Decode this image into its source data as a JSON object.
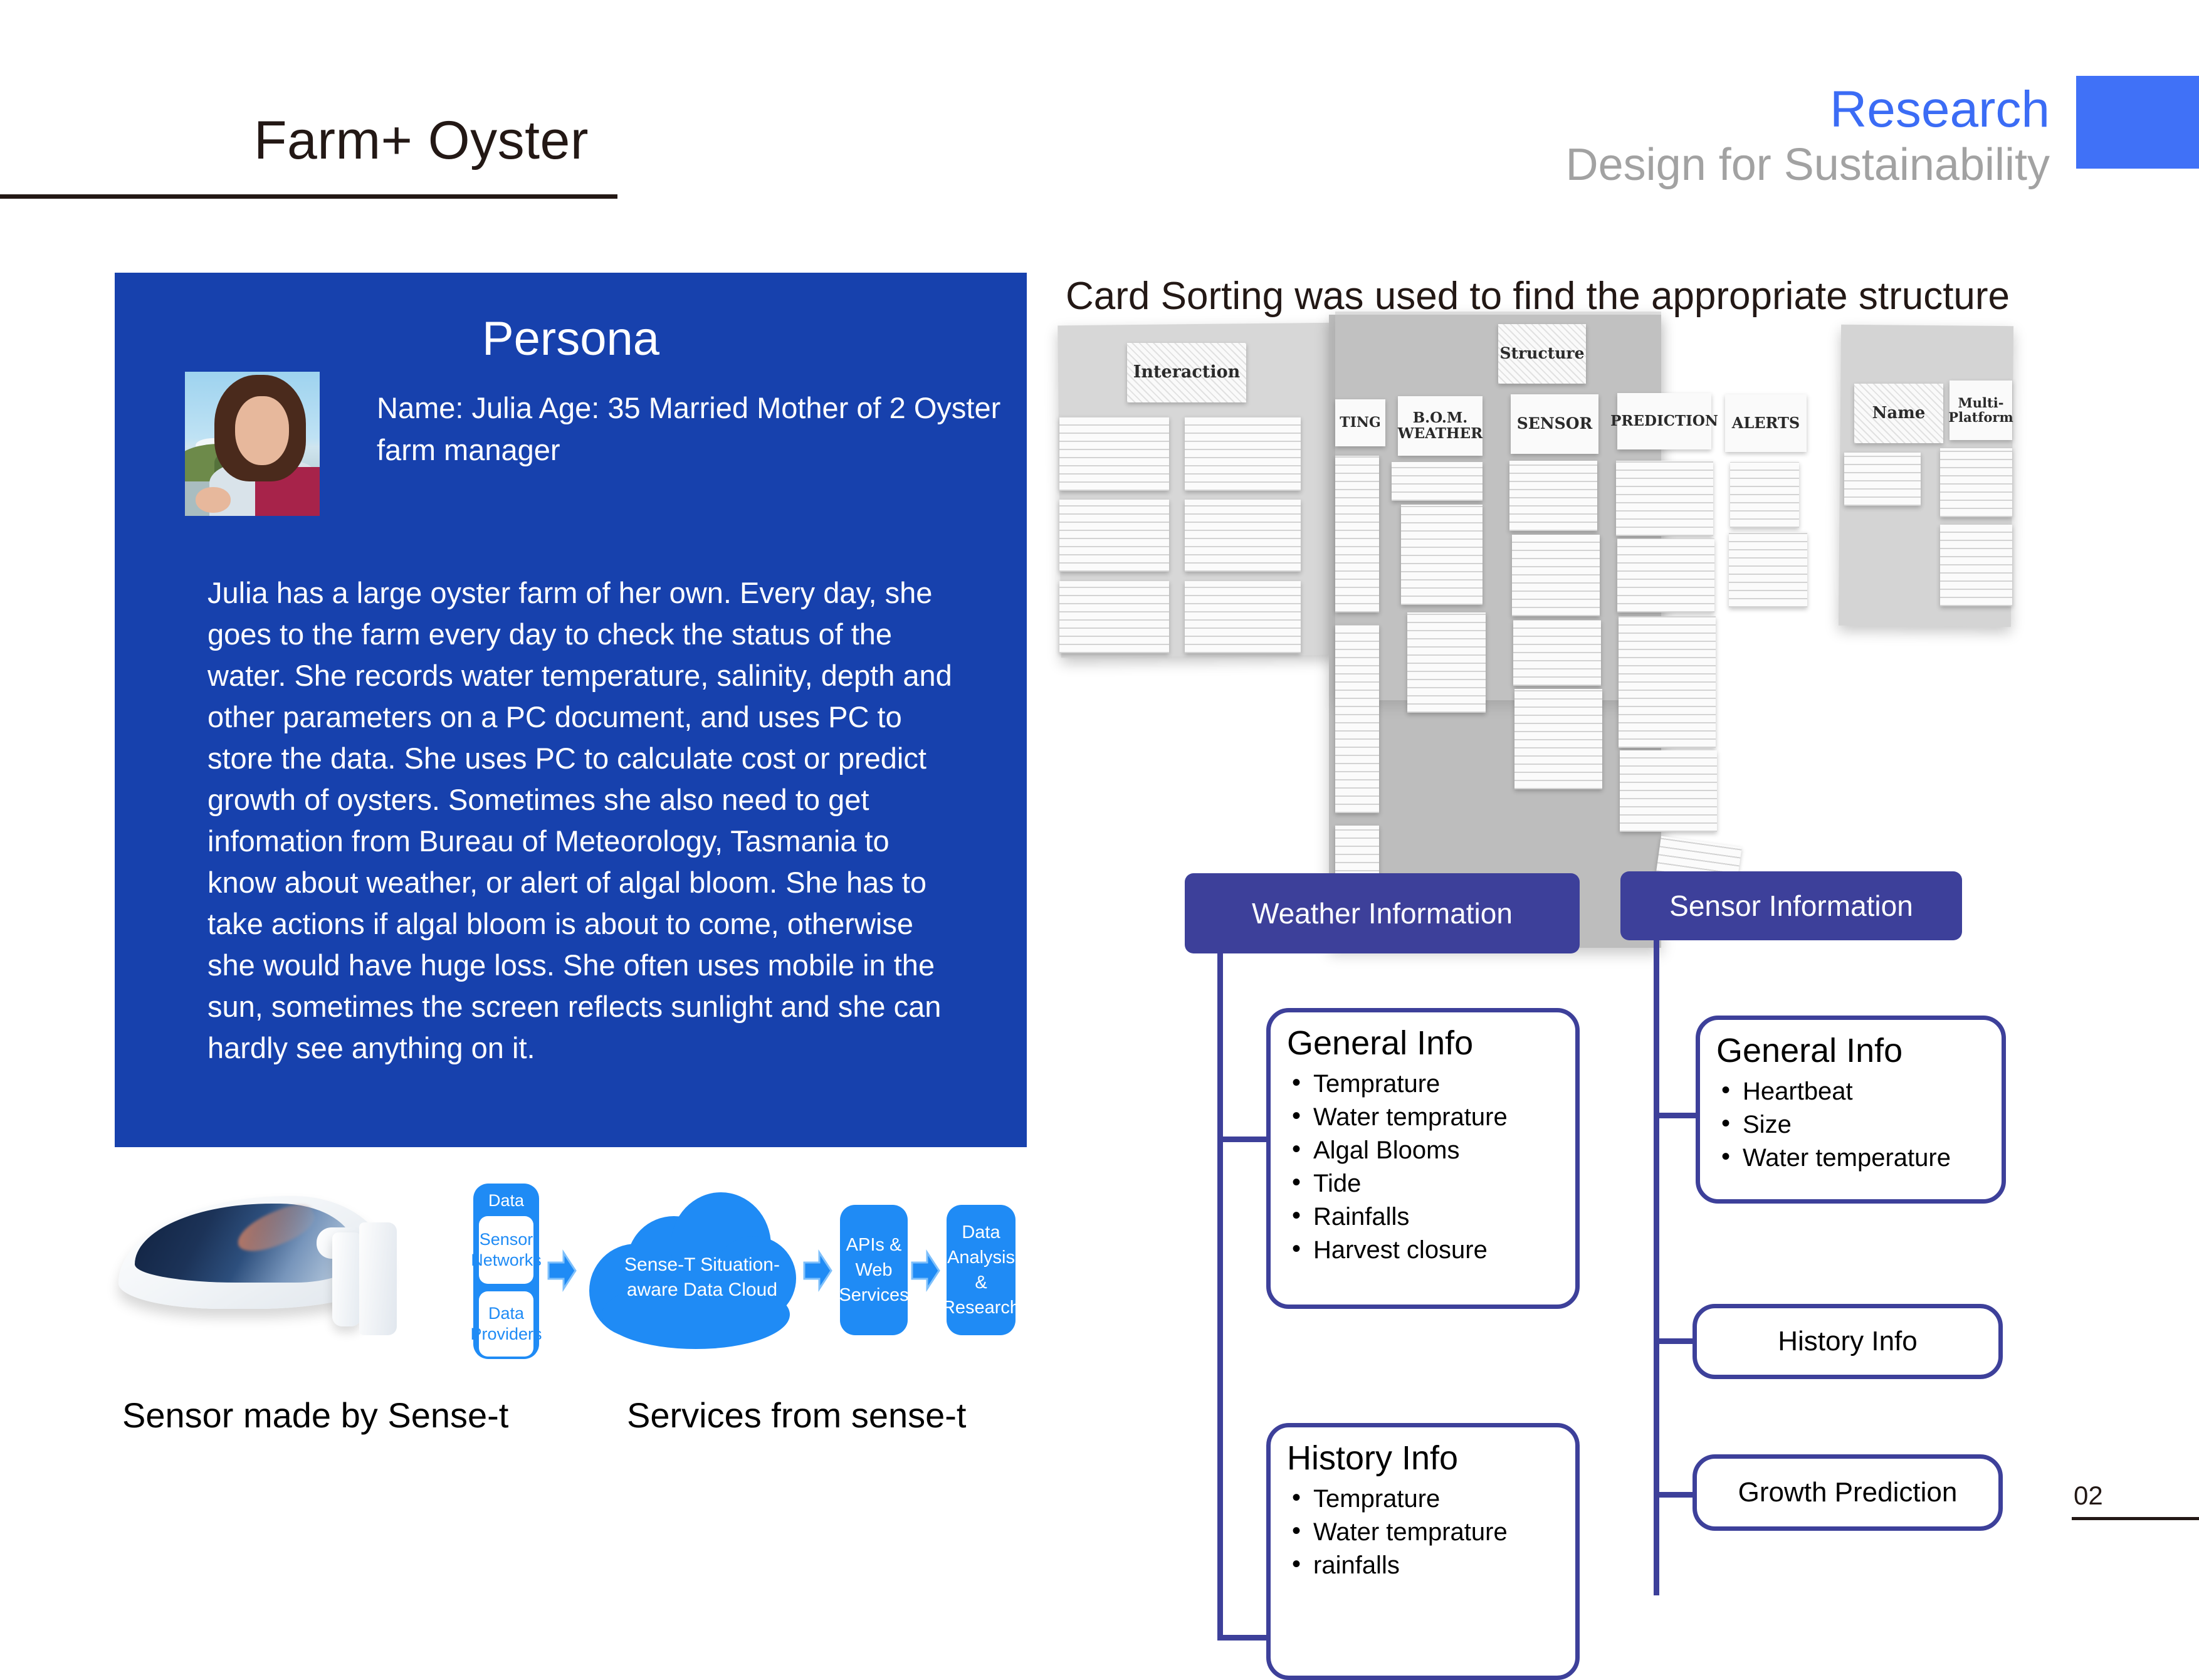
{
  "header": {
    "title": "Farm+ Oyster",
    "research_label": "Research",
    "subtitle": "Design for Sustainability",
    "accent_color": "#4071f7"
  },
  "persona": {
    "heading": "Persona",
    "panel_color": "#1741ad",
    "facts": "Name: Julia\nAge: 35\nMarried\nMother of 2\nOyster farm manager",
    "fields": {
      "name": "Name: Julia",
      "age": "Age: 35",
      "marital_status": "Married",
      "children": "Mother of 2",
      "occupation": "Oyster farm manager"
    },
    "story": "Julia has a large oyster farm of her own. Every day, she goes to the farm every day to check the status of the water. She records water temperature, salinity, depth and other parameters on a PC document, and uses PC to store the data. She uses PC to calculate cost or predict  growth of oysters. Sometimes she also need to get infomation from Bureau of Meteorology, Tasmania to know about weather, or alert of algal bloom. She has to take actions if algal bloom is about to come, otherwise she would have huge loss. She often uses mobile in the sun, sometimes the screen reflects sunlight and she can hardly see anything on it."
  },
  "card_sorting": {
    "heading": "Card Sorting was used to find the appropriate structure",
    "notes": [
      "Interaction",
      "Structure",
      "TING",
      "B.O.M. WEATHER",
      "SENSOR",
      "PREDICTION",
      "ALERTS",
      "Name",
      "Multi-Platform"
    ]
  },
  "flow": {
    "data_group_label": "Data",
    "sensor_networks": "Sensor Networks",
    "data_providers": "Data Providers",
    "cloud": "Sense-T Situation-aware Data Cloud",
    "apis": "APIs & Web Services",
    "analysis": "Data Analysis & Research",
    "accent_color": "#1f8bf5"
  },
  "captions": {
    "sensor": "Sensor made by Sense-t",
    "services": "Services from sense-t"
  },
  "hierarchy": {
    "head_color": "#3d409a",
    "weather": {
      "title": "Weather Information",
      "general": {
        "title": "General Info",
        "items": [
          "Temprature",
          "Water temprature",
          "Algal Blooms",
          "Tide",
          "Rainfalls",
          "Harvest closure"
        ]
      },
      "history": {
        "title": "History Info",
        "items": [
          "Temprature",
          "Water temprature",
          "rainfalls"
        ]
      }
    },
    "sensor": {
      "title": "Sensor Information",
      "general": {
        "title": "General Info",
        "items": [
          "Heartbeat",
          "Size",
          "Water temperature"
        ]
      },
      "history_label": "History Info",
      "growth_label": "Growth Prediction"
    }
  },
  "footer": {
    "page_number": "02"
  }
}
